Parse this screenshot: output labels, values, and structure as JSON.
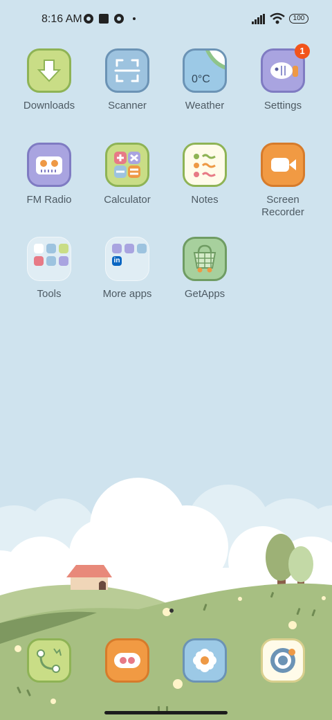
{
  "status_bar": {
    "time": "8:16 AM",
    "battery": "100",
    "icons": [
      "camera-app-icon",
      "square-app-icon",
      "camera-app-icon",
      "dot-icon",
      "signal-icon",
      "wifi-icon",
      "battery-icon"
    ]
  },
  "apps": [
    {
      "label": "Downloads",
      "icon": "download-arrow-icon"
    },
    {
      "label": "Scanner",
      "icon": "scan-frame-icon"
    },
    {
      "label": "Weather",
      "icon": "weather-icon",
      "temp": "0°C"
    },
    {
      "label": "Settings",
      "icon": "fish-gear-icon",
      "badge": "1"
    },
    {
      "label": "FM Radio",
      "icon": "radio-icon"
    },
    {
      "label": "Calculator",
      "icon": "calculator-icon"
    },
    {
      "label": "Notes",
      "icon": "notes-icon"
    },
    {
      "label": "Screen\nRecorder",
      "icon": "video-camera-icon"
    },
    {
      "label": "Tools",
      "icon": "folder-icon"
    },
    {
      "label": "More apps",
      "icon": "folder-icon",
      "mini": "in"
    },
    {
      "label": "GetApps",
      "icon": "shopping-basket-icon"
    }
  ],
  "dock": [
    {
      "name": "phone",
      "icon": "phone-icon"
    },
    {
      "name": "messages",
      "icon": "messages-icon"
    },
    {
      "name": "gallery",
      "icon": "flower-gallery-icon"
    },
    {
      "name": "camera",
      "icon": "camera-lens-icon"
    }
  ],
  "colors": {
    "sky": "#cfe3ee",
    "grass": "#a7bf82",
    "badge": "#f2541b",
    "label": "#4d5a63"
  }
}
